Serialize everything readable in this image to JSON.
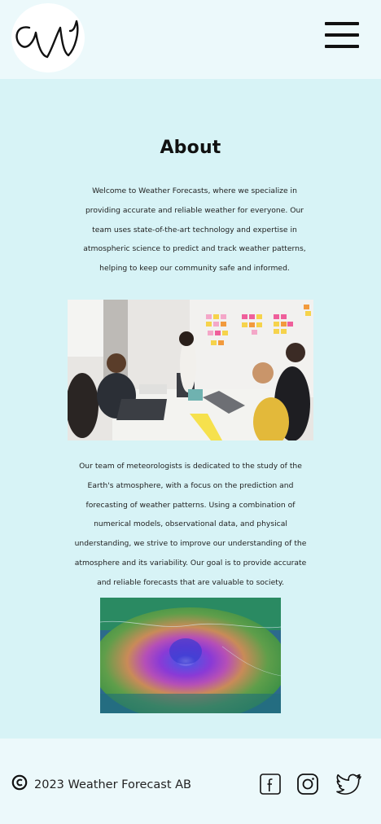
{
  "header": {
    "logo_letter": "W",
    "menu_icon": "hamburger-menu-icon"
  },
  "about": {
    "title": "About",
    "intro": "Welcome to Weather Forecasts, where we specialize in providing accurate and reliable weather for everyone. Our team uses state-of-the-art technology and expertise in atmospheric science to predict and track weather patterns, helping to keep our community safe and informed.",
    "team_text": "Our team of meteorologists is dedicated to the study of the Earth's atmosphere, with a focus on the prediction and forecasting of weather patterns. Using a combination of numerical models, observational data, and physical understanding, we strive to improve our understanding of the atmosphere and its variability. Our goal is to provide accurate and reliable forecasts that are valuable to society."
  },
  "footer": {
    "copyright": "2023 Weather Forecast AB",
    "icons": [
      "copyright-icon",
      "facebook-icon",
      "instagram-icon",
      "twitter-icon"
    ]
  },
  "colors": {
    "page_bg": "#d7f3f6",
    "header_footer_bg": "#ecf9fb",
    "text": "#111111"
  }
}
